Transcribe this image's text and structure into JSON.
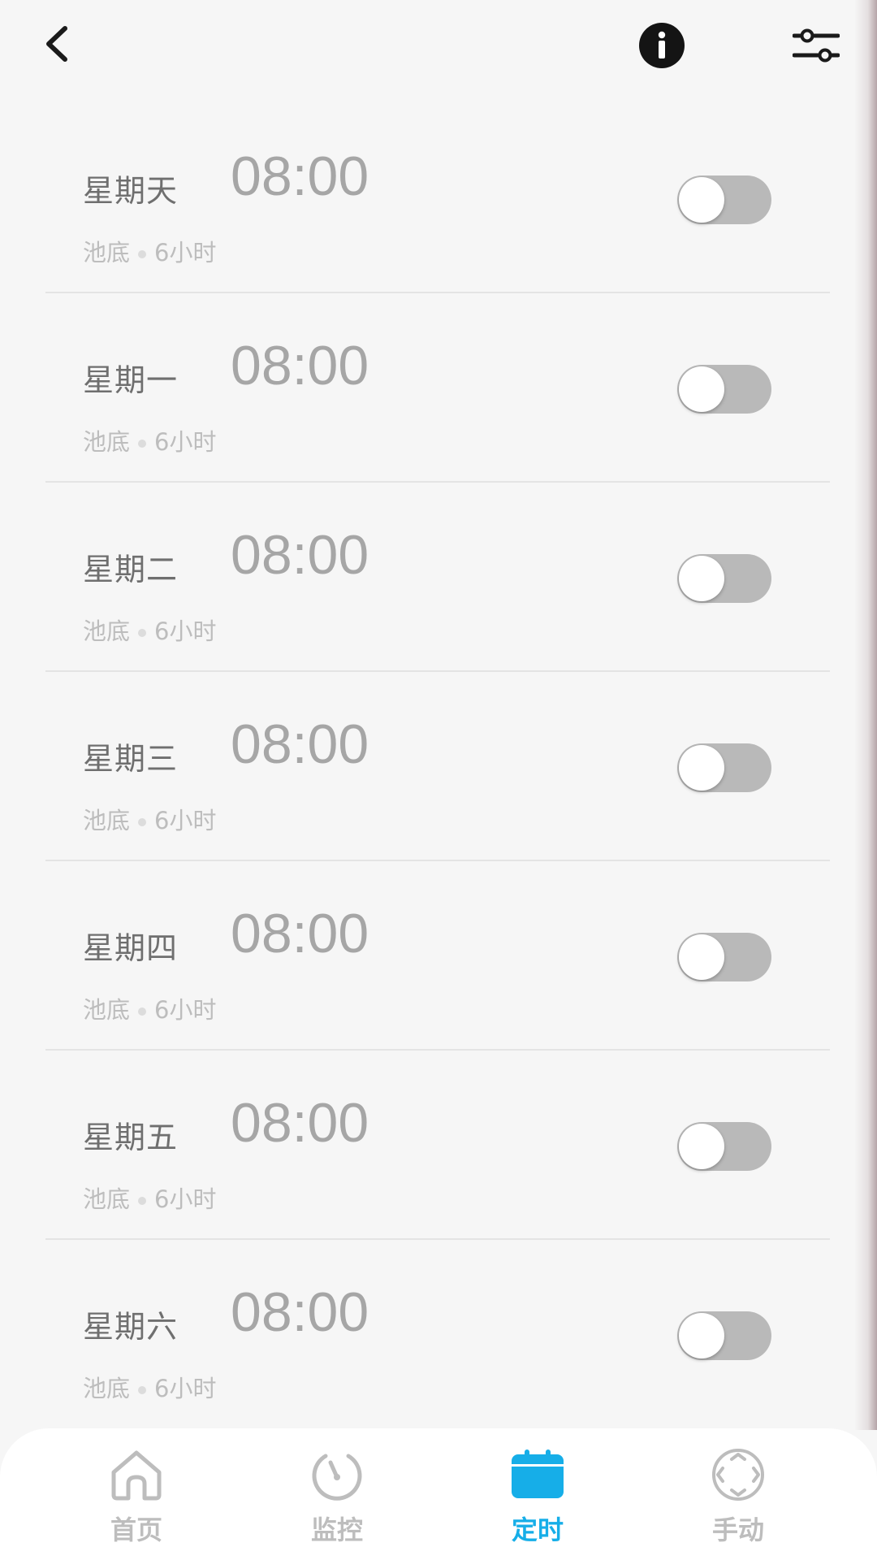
{
  "colors": {
    "accent": "#16aee8",
    "toggle_off": "#b9b9b9",
    "background": "#f6f6f6"
  },
  "header": {
    "back_icon": "chevron-left-icon",
    "info_icon": "info-icon",
    "settings_icon": "sliders-icon"
  },
  "schedule": [
    {
      "day": "星期天",
      "time": "08:00",
      "area": "池底",
      "duration": "6小时",
      "enabled": false
    },
    {
      "day": "星期一",
      "time": "08:00",
      "area": "池底",
      "duration": "6小时",
      "enabled": false
    },
    {
      "day": "星期二",
      "time": "08:00",
      "area": "池底",
      "duration": "6小时",
      "enabled": false
    },
    {
      "day": "星期三",
      "time": "08:00",
      "area": "池底",
      "duration": "6小时",
      "enabled": false
    },
    {
      "day": "星期四",
      "time": "08:00",
      "area": "池底",
      "duration": "6小时",
      "enabled": false
    },
    {
      "day": "星期五",
      "time": "08:00",
      "area": "池底",
      "duration": "6小时",
      "enabled": false
    },
    {
      "day": "星期六",
      "time": "08:00",
      "area": "池底",
      "duration": "6小时",
      "enabled": false
    }
  ],
  "nav": [
    {
      "label": "首页",
      "icon": "home-icon",
      "active": false
    },
    {
      "label": "监控",
      "icon": "monitor-gauge-icon",
      "active": false
    },
    {
      "label": "定时",
      "icon": "calendar-icon",
      "active": true
    },
    {
      "label": "手动",
      "icon": "manual-control-icon",
      "active": false
    }
  ]
}
